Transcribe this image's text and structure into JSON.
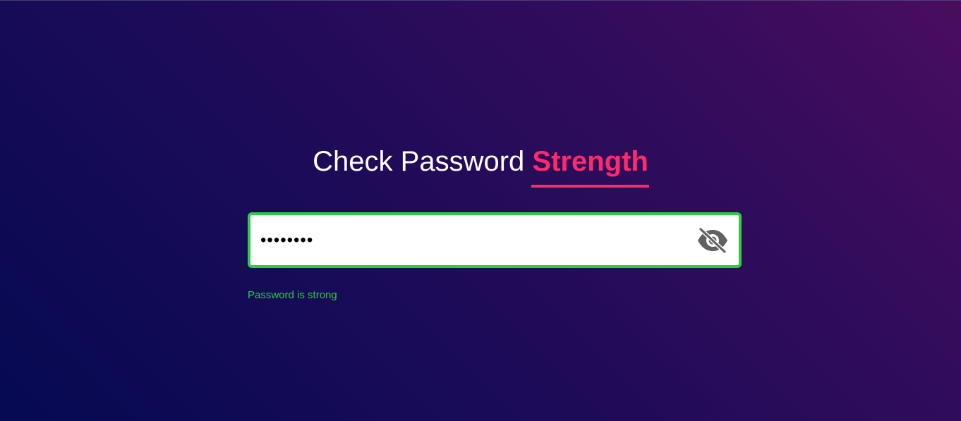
{
  "header": {
    "title_main": "Check Password",
    "title_accent": "Strength"
  },
  "password_field": {
    "value": "••••••••",
    "type": "password",
    "border_color": "#2ecc40",
    "toggle_icon": "eye-slash-icon"
  },
  "status": {
    "text": "Password is strong",
    "color": "#2ecc40"
  },
  "colors": {
    "accent": "#ff2a6d",
    "success": "#2ecc40",
    "background_start": "#050a52",
    "background_end": "#4a0d5e"
  }
}
